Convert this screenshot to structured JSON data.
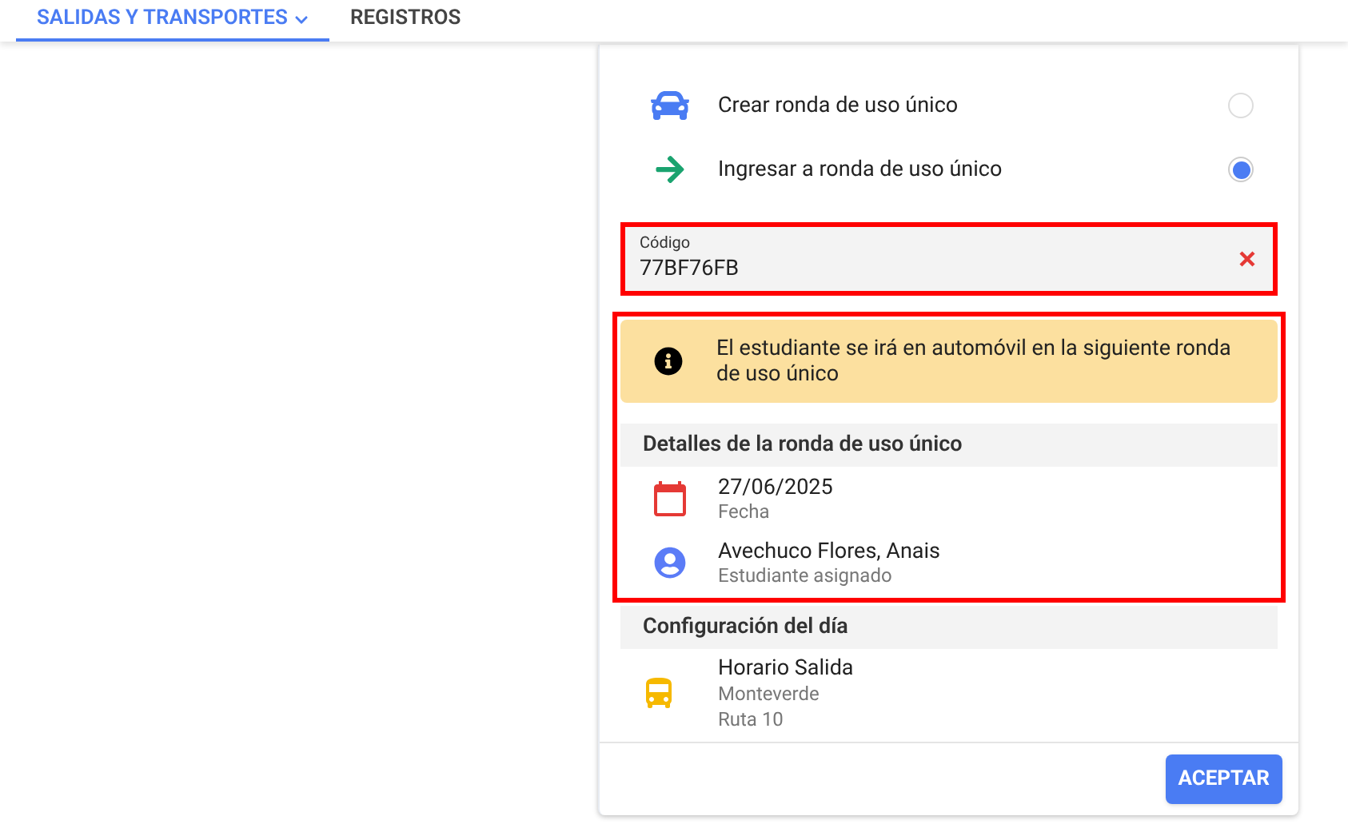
{
  "tabs": [
    {
      "label": "SALIDAS Y TRANSPORTES",
      "selected": true,
      "has_menu": true
    },
    {
      "label": "REGISTROS",
      "selected": false,
      "has_menu": false
    }
  ],
  "options": [
    {
      "kind": "car",
      "label": "Crear ronda de uso único",
      "selected": false
    },
    {
      "kind": "arrow",
      "label": "Ingresar a ronda de uso único",
      "selected": true
    }
  ],
  "code_field": {
    "label": "Código",
    "value": "77BF76FB",
    "highlighted": true
  },
  "summary": {
    "highlighted": true,
    "notice": "El estudiante se irá en automóvil en la siguiente ronda de uso único",
    "section_title": "Detalles de la ronda de uso único",
    "details": [
      {
        "kind": "date",
        "primary": "27/06/2025",
        "secondary": "Fecha"
      },
      {
        "kind": "person",
        "primary": "Avechuco Flores, Anais",
        "secondary": "Estudiante asignado"
      }
    ]
  },
  "day_config": {
    "section_title": "Configuración del día",
    "items": [
      {
        "kind": "bus",
        "lines": [
          "Horario Salida",
          "Monteverde",
          "Ruta 10"
        ]
      }
    ]
  },
  "accept_button": "ACEPTAR"
}
